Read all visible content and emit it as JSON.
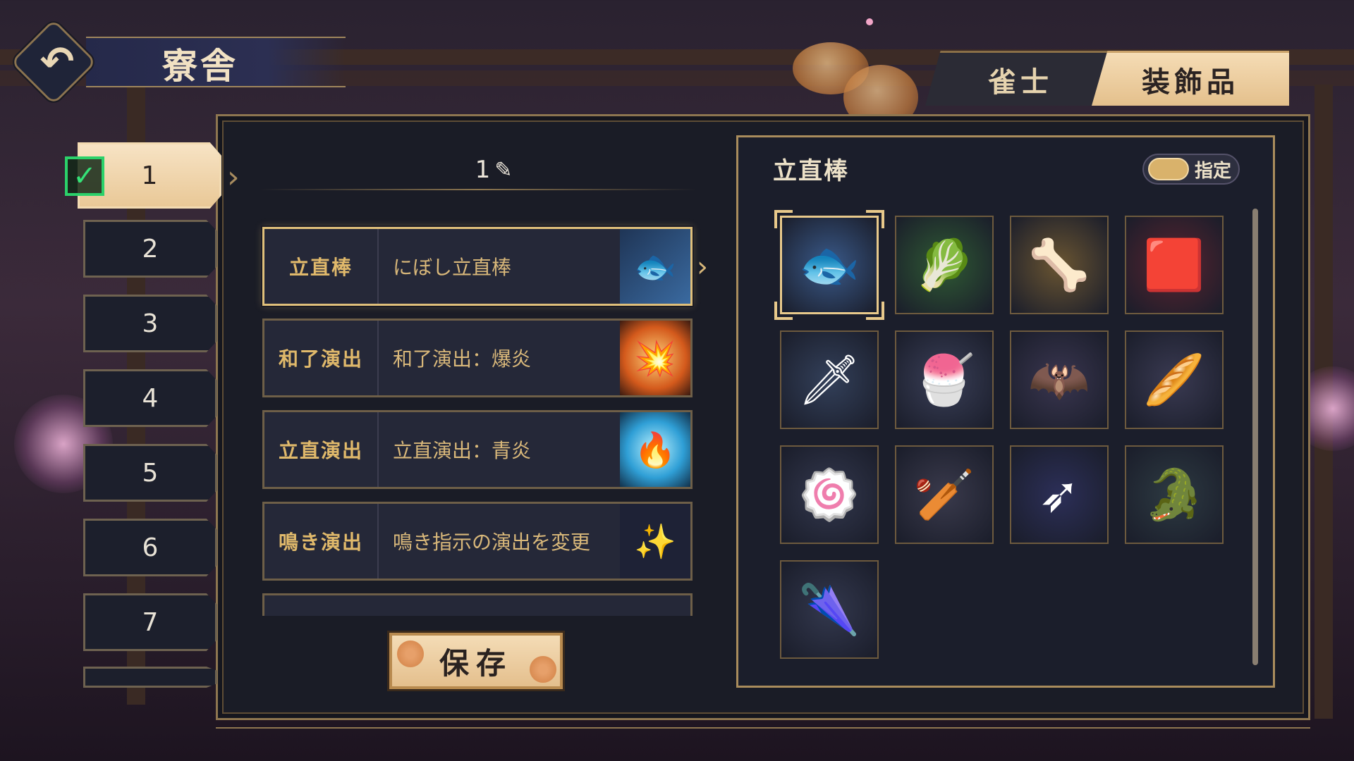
{
  "header": {
    "back_icon": "undo-arrow-icon",
    "title": "寮舎"
  },
  "tabs": [
    {
      "label": "雀士",
      "active": false
    },
    {
      "label": "装飾品",
      "active": true
    }
  ],
  "slots": {
    "items": [
      {
        "label": "1",
        "selected": true,
        "checked": true
      },
      {
        "label": "2"
      },
      {
        "label": "3"
      },
      {
        "label": "4"
      },
      {
        "label": "5"
      },
      {
        "label": "6"
      },
      {
        "label": "7"
      }
    ]
  },
  "loadout": {
    "name": "1",
    "edit_icon": "pencil-edit-icon",
    "rows": [
      {
        "category": "立直棒",
        "value": "にぼし立直棒",
        "thumb_icon": "fish-icon",
        "selected": true
      },
      {
        "category": "和了演出",
        "value": "和了演出：爆炎",
        "thumb_icon": "fire-burst-icon"
      },
      {
        "category": "立直演出",
        "value": "立直演出：青炎",
        "thumb_icon": "blue-flame-icon"
      },
      {
        "category": "鳴き演出",
        "value": "鳴き指示の演出を変更",
        "thumb_icon": "sparkle-box-icon"
      }
    ],
    "save_label": "保存"
  },
  "panel": {
    "title": "立直棒",
    "toggle_label": "指定",
    "toggle_on": true,
    "items": [
      {
        "name": "fish-stick-icon",
        "glyph": "🐟",
        "bg": "#3a5a8a",
        "selected": true
      },
      {
        "name": "leek-stick-icon",
        "glyph": "🥬",
        "bg": "#2f5a34"
      },
      {
        "name": "bone-stick-icon",
        "glyph": "🦴",
        "bg": "#6a5532"
      },
      {
        "name": "red-stick-icon",
        "glyph": "🟥",
        "bg": "#5a2430"
      },
      {
        "name": "pixel-sword-icon",
        "glyph": "🗡",
        "bg": "#33405a"
      },
      {
        "name": "popsicle-icon",
        "glyph": "🍧",
        "bg": "#3a3f58"
      },
      {
        "name": "bat-wing-icon",
        "glyph": "🦇",
        "bg": "#3a3650"
      },
      {
        "name": "baguette-icon",
        "glyph": "🥖",
        "bg": "#3a3a52"
      },
      {
        "name": "naruto-skewer-icon",
        "glyph": "🍥",
        "bg": "#33384e"
      },
      {
        "name": "baseball-bat-icon",
        "glyph": "🏏",
        "bg": "#3a3a4c"
      },
      {
        "name": "neon-arrow-icon",
        "glyph": "➶",
        "bg": "#2c2f58"
      },
      {
        "name": "crocodile-icon",
        "glyph": "🐊",
        "bg": "#2d3a42"
      },
      {
        "name": "umbrella-icon",
        "glyph": "🌂",
        "bg": "#33384e"
      }
    ]
  },
  "colors": {
    "accent_gold": "#e0c07a",
    "panel_bg": "#1b1e2b",
    "tab_active": "#f5dcb5",
    "check_green": "#2bd16a"
  }
}
